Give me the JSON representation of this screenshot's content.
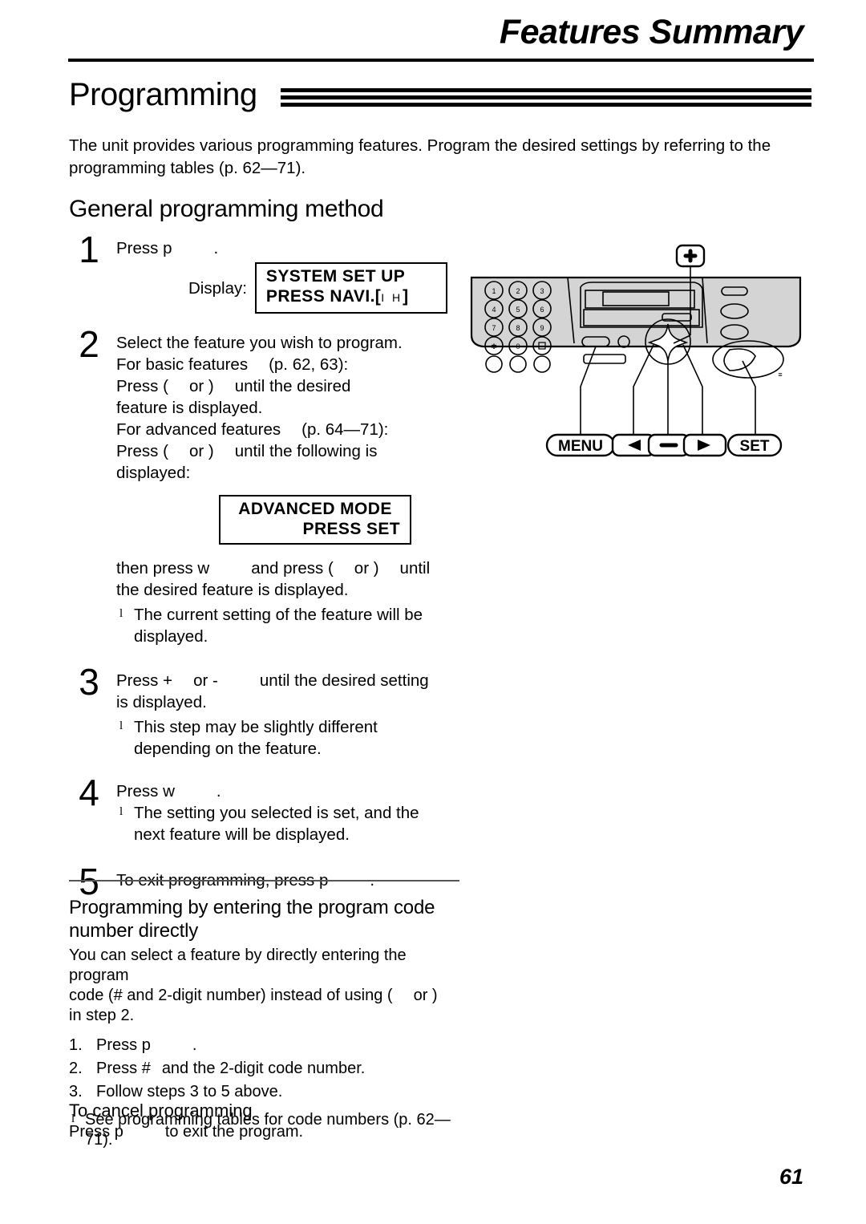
{
  "header": {
    "chapter_title": "Features Summary"
  },
  "section": {
    "title": "Programming",
    "intro": "The unit provides various programming features. Program the desired settings by referring to the programming tables (p. 62—71).",
    "subheading": "General programming method"
  },
  "steps": [
    {
      "num": "1",
      "line1_pre": "Press ",
      "line1_key": "p",
      "line1_post": ".",
      "display_label": "Display:",
      "lcd_line1": "SYSTEM SET UP",
      "lcd_line2_pre": "PRESS NAVI.[",
      "lcd_line2_nav": "I H",
      "lcd_line2_post": "]"
    },
    {
      "num": "2",
      "line1": "Select the feature you wish to program.",
      "line2_pre": "For basic features",
      "line2_post": "(p. 62, 63):",
      "line3_pre": "Press (",
      "line3_mid": "or )",
      "line3_post": "until the desired",
      "line4": "feature is displayed.",
      "line5_pre": "For advanced features",
      "line5_post": "(p. 64—71):",
      "line6_pre": "Press (",
      "line6_mid": "or )",
      "line6_post": "until the following is",
      "line7": "displayed:",
      "lcd_line1": "ADVANCED MODE",
      "lcd_line2": "PRESS SET",
      "after_pre": "then press ",
      "after_key": "w",
      "after_mid": "and press (",
      "after_mid2": "or )",
      "after_post": "until",
      "after_line2": "the desired feature is displayed.",
      "bullet1": "The current setting of the feature will be",
      "bullet1_cont": "displayed."
    },
    {
      "num": "3",
      "line1_pre": "Press ",
      "line1_key1": "+",
      "line1_mid": "or ",
      "line1_key2": "-",
      "line1_post": "until the desired setting",
      "line2": "is displayed.",
      "bullet1": "This step may be slightly different",
      "bullet1_cont": "depending on the feature."
    },
    {
      "num": "4",
      "line1_pre": "Press ",
      "line1_key": "w",
      "line1_post": ".",
      "bullet1": "The setting you selected is set, and the",
      "bullet1_cont": "next feature will be displayed."
    },
    {
      "num": "5",
      "line1_pre": "To exit programming, press ",
      "line1_key": "p",
      "line1_post": "."
    }
  ],
  "subsection2": {
    "title_line1": "Programming by entering the program code",
    "title_line2": "number directly",
    "para_line1": "You can select a feature by directly entering the program",
    "para_line2_pre": "code (# and 2-digit number) instead of using (",
    "para_line2_post": "or )",
    "para_line3": "in step 2.",
    "items": [
      {
        "idx": "1.",
        "text_pre": "Press ",
        "key": "p",
        "text_post": "."
      },
      {
        "idx": "2.",
        "text_pre": "Press ",
        "key": "#",
        "text_post": "and the 2-digit code number."
      },
      {
        "idx": "3.",
        "text_pre": "Follow steps 3 to 5 above.",
        "key": "",
        "text_post": ""
      }
    ],
    "note": "See programming tables for code numbers (p. 62—71)."
  },
  "cancel": {
    "title": "To cancel programming",
    "text_pre": "Press ",
    "key": "p",
    "text_post": "to exit the program."
  },
  "page_number": "61",
  "device": {
    "callouts": {
      "plus": "+",
      "menu": "MENU",
      "left": "◀",
      "minus": "–",
      "right": "▶",
      "set": "SET"
    },
    "keypad": [
      "1",
      "2",
      "3",
      "4",
      "5",
      "6",
      "7",
      "8",
      "9",
      "✱",
      "0",
      "□"
    ]
  }
}
